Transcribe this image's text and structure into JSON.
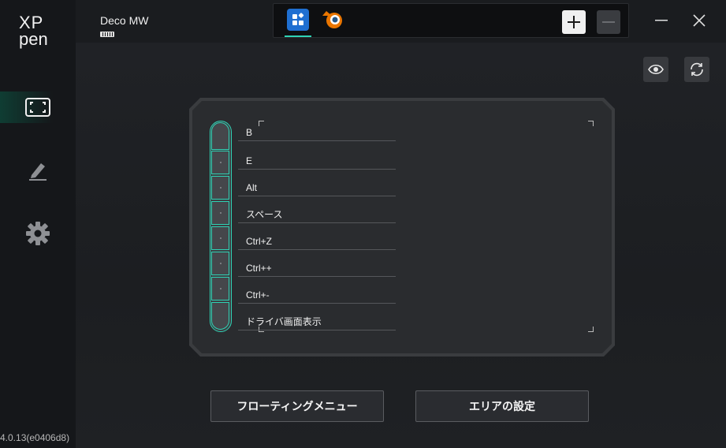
{
  "app": {
    "logo_text": "XPpen",
    "version": "4.0.13(e0406d8)"
  },
  "sidebar": {
    "items": [
      {
        "icon": "working-area-icon",
        "active": true
      },
      {
        "icon": "pen-icon",
        "active": false
      },
      {
        "icon": "gear-icon",
        "active": false
      }
    ]
  },
  "device": {
    "name": "Deco MW",
    "battery_icon": "battery-icon"
  },
  "app_tabs": [
    {
      "icon": "all-apps-icon",
      "selected": true
    },
    {
      "icon": "blender-icon",
      "selected": false
    }
  ],
  "window_controls": {
    "minimize_icon": "minimize-icon",
    "close_icon": "close-icon"
  },
  "express_keys": [
    {
      "label": "B"
    },
    {
      "label": "E"
    },
    {
      "label": "Alt"
    },
    {
      "label": "スペース"
    },
    {
      "label": "Ctrl+Z"
    },
    {
      "label": "Ctrl++"
    },
    {
      "label": "Ctrl+-"
    },
    {
      "label": "ドライバ画面表示"
    }
  ],
  "buttons": {
    "floating_menu": "フローティングメニュー",
    "area_settings": "エリアの設定"
  },
  "colors": {
    "accent": "#2fd3b5",
    "background": "#1b1d20"
  }
}
